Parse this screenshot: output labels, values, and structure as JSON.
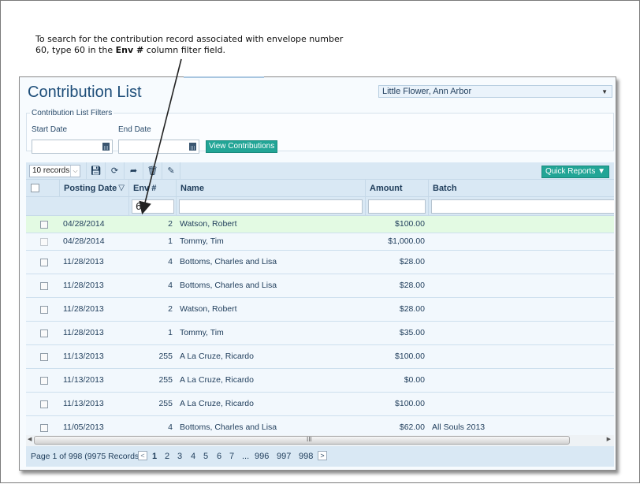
{
  "callout": {
    "line1": "To search for the contribution record associated with envelope number",
    "line2_pre": "60, type 60 in the ",
    "line2_bold": "Env #",
    "line2_post": " column filter field."
  },
  "page": {
    "title": "Contribution List",
    "parish_select": "Little Flower, Ann Arbor"
  },
  "filters": {
    "legend": "Contribution List Filters",
    "start_date_label": "Start Date",
    "end_date_label": "End Date",
    "start_date_value": "",
    "end_date_value": "",
    "view_button": "View Contributions"
  },
  "toolbar": {
    "page_size": "10 records",
    "icons": [
      "save-icon",
      "refresh-icon",
      "forward-icon",
      "trash-icon",
      "pencil-icon"
    ],
    "quick_reports": "Quick Reports ▼"
  },
  "columns": {
    "posting_date": "Posting Date",
    "env": "Env #",
    "name": "Name",
    "amount": "Amount",
    "batch": "Batch"
  },
  "column_filters": {
    "env": "60",
    "name": "",
    "amount": "",
    "batch": ""
  },
  "rows": [
    {
      "date": "04/28/2014",
      "env": "2",
      "name": "Watson, Robert",
      "amount": "$100.00",
      "batch": ""
    },
    {
      "date": "04/28/2014",
      "env": "1",
      "name": "Tommy, Tim",
      "amount": "$1,000.00",
      "batch": ""
    },
    {
      "date": "11/28/2013",
      "env": "4",
      "name": "Bottoms, Charles and Lisa",
      "amount": "$28.00",
      "batch": ""
    },
    {
      "date": "11/28/2013",
      "env": "4",
      "name": "Bottoms, Charles and Lisa",
      "amount": "$28.00",
      "batch": ""
    },
    {
      "date": "11/28/2013",
      "env": "2",
      "name": "Watson, Robert",
      "amount": "$28.00",
      "batch": ""
    },
    {
      "date": "11/28/2013",
      "env": "1",
      "name": "Tommy, Tim",
      "amount": "$35.00",
      "batch": ""
    },
    {
      "date": "11/13/2013",
      "env": "255",
      "name": "A La Cruze, Ricardo",
      "amount": "$100.00",
      "batch": ""
    },
    {
      "date": "11/13/2013",
      "env": "255",
      "name": "A La Cruze, Ricardo",
      "amount": "$0.00",
      "batch": ""
    },
    {
      "date": "11/13/2013",
      "env": "255",
      "name": "A La Cruze, Ricardo",
      "amount": "$100.00",
      "batch": ""
    },
    {
      "date": "11/05/2013",
      "env": "4",
      "name": "Bottoms, Charles and Lisa",
      "amount": "$62.00",
      "batch": "All Souls 2013"
    }
  ],
  "pager": {
    "info": "Page 1 of 998 (9975 Records)",
    "prev": "<",
    "next": ">",
    "pages": [
      "1",
      "2",
      "3",
      "4",
      "5",
      "6",
      "7",
      "...",
      "996",
      "997",
      "998"
    ],
    "current": "1"
  },
  "colors": {
    "accent_teal": "#22a596",
    "title_blue": "#1e4e79",
    "header_bg": "#d9e8f4",
    "selected_row": "#e3fae3"
  }
}
